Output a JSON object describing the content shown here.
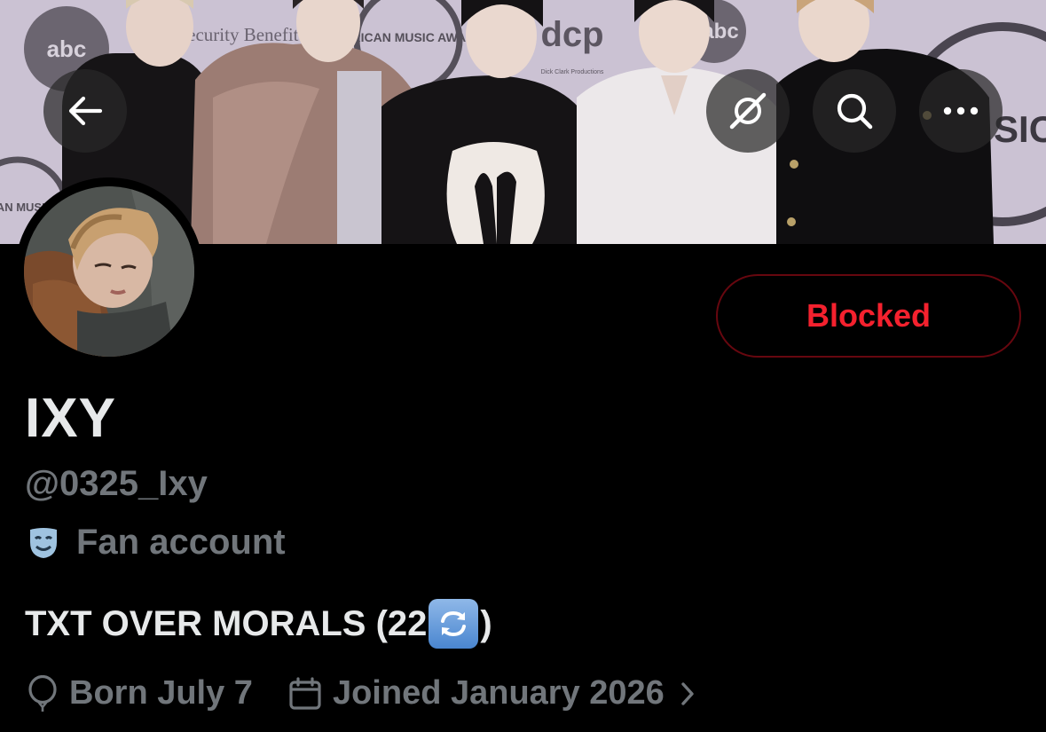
{
  "banner": {
    "signs": [
      "abc",
      "Security Benefit",
      "AMERICAN MUSIC AWARDS",
      "dcp",
      "Dick Clark Productions",
      "abc",
      "ERICAN MUSI WA",
      "ICA SIC RD"
    ]
  },
  "nav": {
    "back_icon": "arrow-left-icon",
    "grok_icon": "grok-icon",
    "search_icon": "search-icon",
    "more_icon": "more-horizontal-icon"
  },
  "profile": {
    "display_name": "IXY",
    "handle": "@0325_Ixy",
    "label_icon": "theater-masks-icon",
    "label": "Fan account",
    "bio_text": "TXT OVER MORALS (22",
    "bio_emoji": "repeat-emoji",
    "bio_close": ")",
    "birthday": "Born July 7",
    "joined": "Joined January 2026"
  },
  "actions": {
    "blocked_label": "Blocked"
  },
  "colors": {
    "background": "#000000",
    "primary_text": "#e7e9ea",
    "secondary_text": "#71767b",
    "blocked_red": "#f4212e",
    "blocked_border": "#67070f"
  }
}
